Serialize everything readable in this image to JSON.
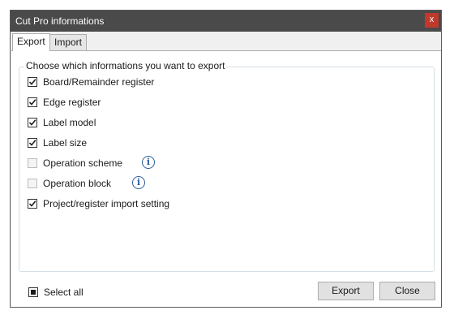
{
  "window": {
    "title": "Cut Pro informations",
    "close_label": "x"
  },
  "tabs": [
    {
      "label": "Export",
      "active": true
    },
    {
      "label": "Import",
      "active": false
    }
  ],
  "group": {
    "legend": "Choose which informations you want to export",
    "options": [
      {
        "label": "Board/Remainder register",
        "checked": true,
        "enabled": true,
        "info": false
      },
      {
        "label": "Edge register",
        "checked": true,
        "enabled": true,
        "info": false
      },
      {
        "label": "Label model",
        "checked": true,
        "enabled": true,
        "info": false
      },
      {
        "label": "Label size",
        "checked": true,
        "enabled": true,
        "info": false
      },
      {
        "label": "Operation scheme",
        "checked": false,
        "enabled": false,
        "info": true
      },
      {
        "label": "Operation block",
        "checked": false,
        "enabled": false,
        "info": true
      },
      {
        "label": "Project/register import setting",
        "checked": true,
        "enabled": true,
        "info": false
      }
    ]
  },
  "select_all": {
    "label": "Select all",
    "state": "indeterminate"
  },
  "buttons": {
    "export": "Export",
    "close": "Close"
  },
  "icons": {
    "info": "info-circle-icon",
    "check": "checkmark-icon"
  },
  "colors": {
    "titlebar": "#4a4a4a",
    "close": "#c0392b",
    "info": "#2e5e9e"
  }
}
